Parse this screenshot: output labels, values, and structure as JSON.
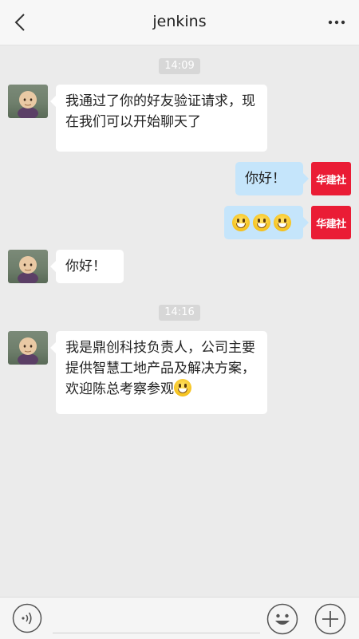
{
  "header": {
    "title": "jenkins"
  },
  "messages": {
    "m1": {
      "text": "我通过了你的好友验证请求，现在我们可以开始聊天了"
    },
    "m2": {
      "text": "你好！"
    },
    "m4": {
      "text": "你好！"
    },
    "m5": {
      "text": "我是鼎创科技负责人，公司主要提供智慧工地产品及解决方案，欢迎陈总考察参观"
    }
  },
  "timestamps": {
    "t1": "14:09",
    "t2": "14:16"
  },
  "self_avatar": {
    "label": "华建社"
  },
  "colors": {
    "accent_red": "#ea1c35",
    "self_bubble": "#c5e5fb",
    "background": "#ebebeb"
  },
  "icons": {
    "back": "back-arrow-icon",
    "more": "more-icon",
    "voice": "voice-icon",
    "emoji": "smiley-icon",
    "plus": "plus-icon"
  },
  "input": {
    "value": ""
  }
}
